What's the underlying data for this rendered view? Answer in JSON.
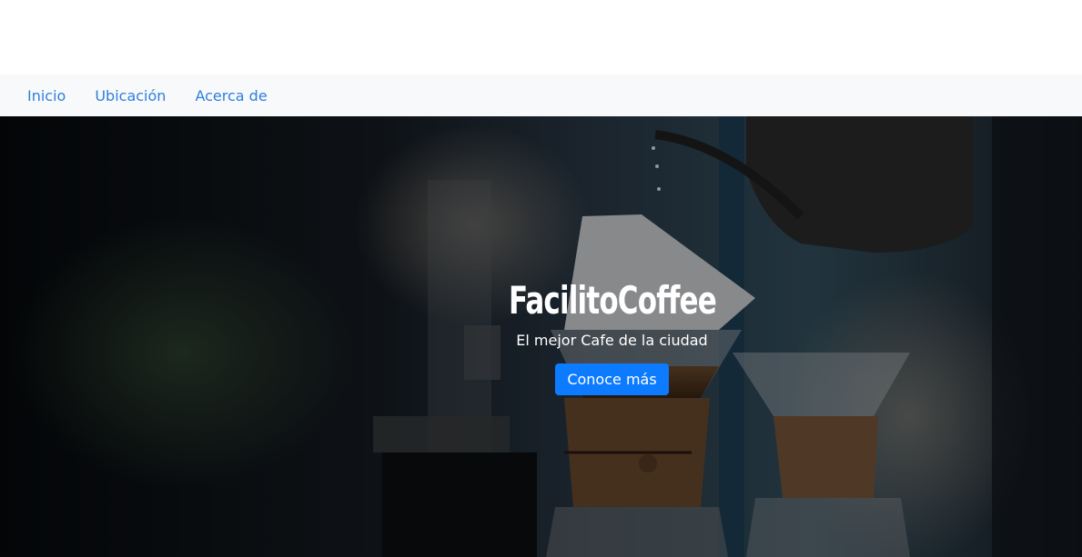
{
  "nav": {
    "items": [
      {
        "label": "Inicio"
      },
      {
        "label": "Ubicación"
      },
      {
        "label": "Acerca de"
      }
    ]
  },
  "hero": {
    "title": "FacilitoCoffee",
    "subtitle": "El mejor Cafe de la ciudad",
    "button_label": "Conoce más",
    "image": "coffee-pour-over-photo"
  },
  "colors": {
    "nav_link": "#2f7ee0",
    "navbar_bg": "#f8f9fa",
    "button_bg": "#0d7bff"
  }
}
